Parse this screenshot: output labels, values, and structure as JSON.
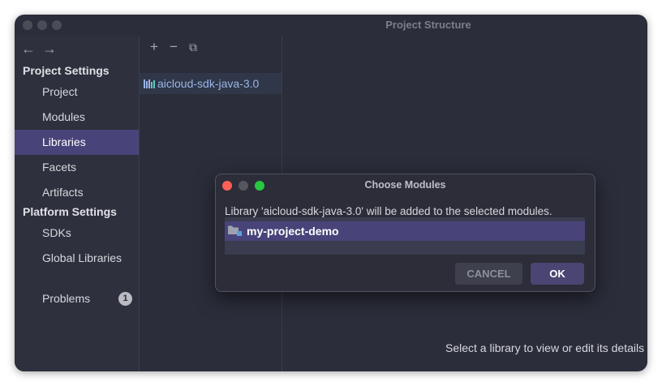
{
  "window": {
    "title": "Project Structure"
  },
  "nav": {
    "back_icon": "arrow-left-icon",
    "forward_icon": "arrow-right-icon",
    "back_glyph": "←",
    "forward_glyph": "→"
  },
  "sidebar": {
    "project_settings_heading": "Project Settings",
    "project_items": [
      {
        "label": "Project"
      },
      {
        "label": "Modules"
      },
      {
        "label": "Libraries",
        "selected": true
      },
      {
        "label": "Facets"
      },
      {
        "label": "Artifacts"
      }
    ],
    "platform_settings_heading": "Platform Settings",
    "platform_items": [
      {
        "label": "SDKs"
      },
      {
        "label": "Global Libraries"
      }
    ],
    "problems": {
      "label": "Problems",
      "count": "1"
    }
  },
  "library_pane": {
    "toolbar": {
      "add_glyph": "+",
      "remove_glyph": "−",
      "copy_glyph": "⧉"
    },
    "libraries": [
      {
        "label": "aicloud-sdk-java-3.0",
        "icon": "library-icon"
      }
    ]
  },
  "content": {
    "message": "Select a library to view or edit its details"
  },
  "dialog": {
    "title": "Choose Modules",
    "message": "Library 'aicloud-sdk-java-3.0' will be added to the selected modules.",
    "modules": [
      {
        "label": "my-project-demo",
        "icon": "module-folder-icon"
      }
    ],
    "cancel_label": "CANCEL",
    "ok_label": "OK"
  },
  "colors": {
    "window_bg": "#2b2d3a",
    "selection": "#48447a",
    "dialog_bg": "#2c2d38",
    "close": "#ff5f57",
    "minimize": "#febc2e",
    "maximize": "#28c840"
  }
}
